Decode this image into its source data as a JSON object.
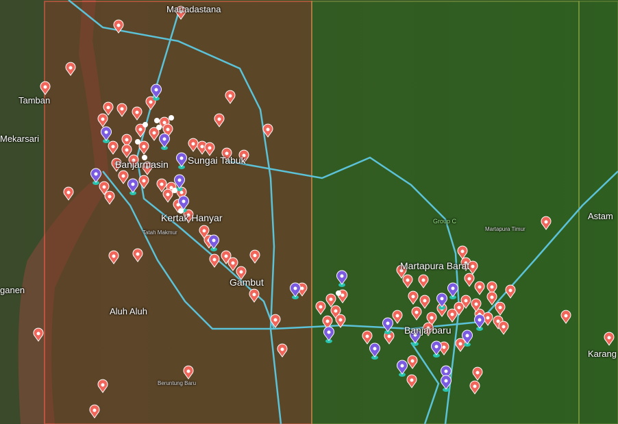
{
  "map": {
    "places": [
      "Martadastana",
      "Tamban",
      "Mekarsari",
      "Banjarmasin",
      "Sungai Tabuk",
      "Kertak Hanyar",
      "Tatah Makmur",
      "Gambut",
      "Aluh Aluh",
      "Beruntung Baru",
      "Martapura Barat",
      "Banjarbaru",
      "Martapura Timur",
      "Astam",
      "Karang",
      "ganen"
    ],
    "groups": [
      "Group C"
    ],
    "colors": {
      "region_left": "#8a4a2e",
      "region_mid": "#3d7a2a",
      "line": "#5cc2d8",
      "marker_red": "#f0665a",
      "marker_purple": "#7b5ce0",
      "boundary_red": "#ff5b4a",
      "boundary_yellow": "#d7e060"
    }
  }
}
